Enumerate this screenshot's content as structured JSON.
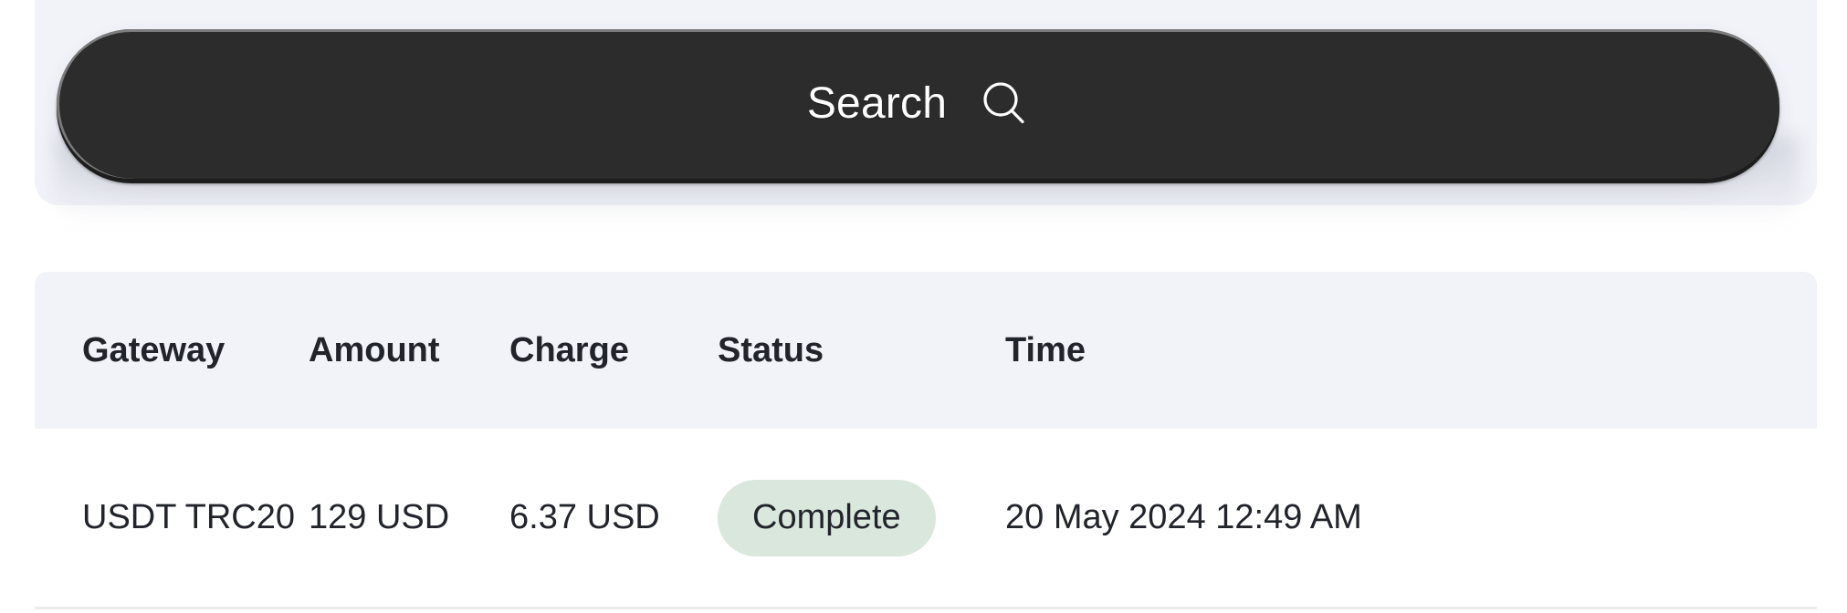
{
  "search_panel": {
    "input": {
      "value": "",
      "placeholder": ""
    },
    "button": {
      "label": "Search",
      "icon": "search-icon"
    }
  },
  "table": {
    "columns": [
      {
        "key": "gateway",
        "label": "Gateway"
      },
      {
        "key": "amount",
        "label": "Amount"
      },
      {
        "key": "charge",
        "label": "Charge"
      },
      {
        "key": "status",
        "label": "Status"
      },
      {
        "key": "time",
        "label": "Time"
      }
    ],
    "rows": [
      {
        "gateway": "USDT TRC20",
        "amount": "129 USD",
        "charge": "6.37 USD",
        "status": "Complete",
        "time": "20 May 2024 12:49 AM"
      }
    ]
  },
  "colors": {
    "page_background": "#ffffff",
    "panel_background": "#f2f3f9",
    "table_header_background": "#f2f3f9",
    "button_background": "#2c2c2c",
    "button_text": "#ffffff",
    "text_primary": "#22242b",
    "text_muted": "#93a0ab",
    "status_complete_background": "#d9e7dc",
    "status_complete_text": "#22242b",
    "row_divider": "#ececef"
  }
}
